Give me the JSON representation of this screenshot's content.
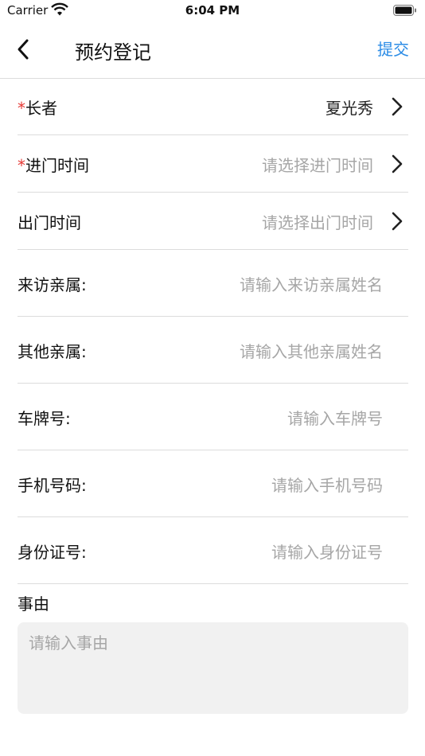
{
  "status": {
    "carrier": "Carrier",
    "time": "6:04 PM"
  },
  "nav": {
    "title": "预约登记",
    "submit": "提交"
  },
  "rows": [
    {
      "label": "长者",
      "required": "*",
      "value": "夏光秀"
    },
    {
      "label": "进门时间",
      "required": "*",
      "placeholder": "请选择进门时间"
    },
    {
      "label": "出门时间",
      "placeholder": "请选择出门时间"
    },
    {
      "label": "来访亲属:",
      "placeholder": "请输入来访亲属姓名"
    },
    {
      "label": "其他亲属:",
      "placeholder": "请输入其他亲属姓名"
    },
    {
      "label": "车牌号:",
      "placeholder": "请输入车牌号"
    },
    {
      "label": "手机号码:",
      "placeholder": "请输入手机号码"
    },
    {
      "label": "身份证号:",
      "placeholder": "请输入身份证号"
    }
  ],
  "reason": {
    "label": "事由",
    "placeholder": "请输入事由"
  },
  "colors": {
    "accent": "#2a8be6",
    "required": "#e53935",
    "placeholder": "#a6a6a6"
  },
  "icons": [
    "wifi-icon",
    "battery-icon",
    "back-chevron-icon",
    "chevron-right-icon"
  ]
}
